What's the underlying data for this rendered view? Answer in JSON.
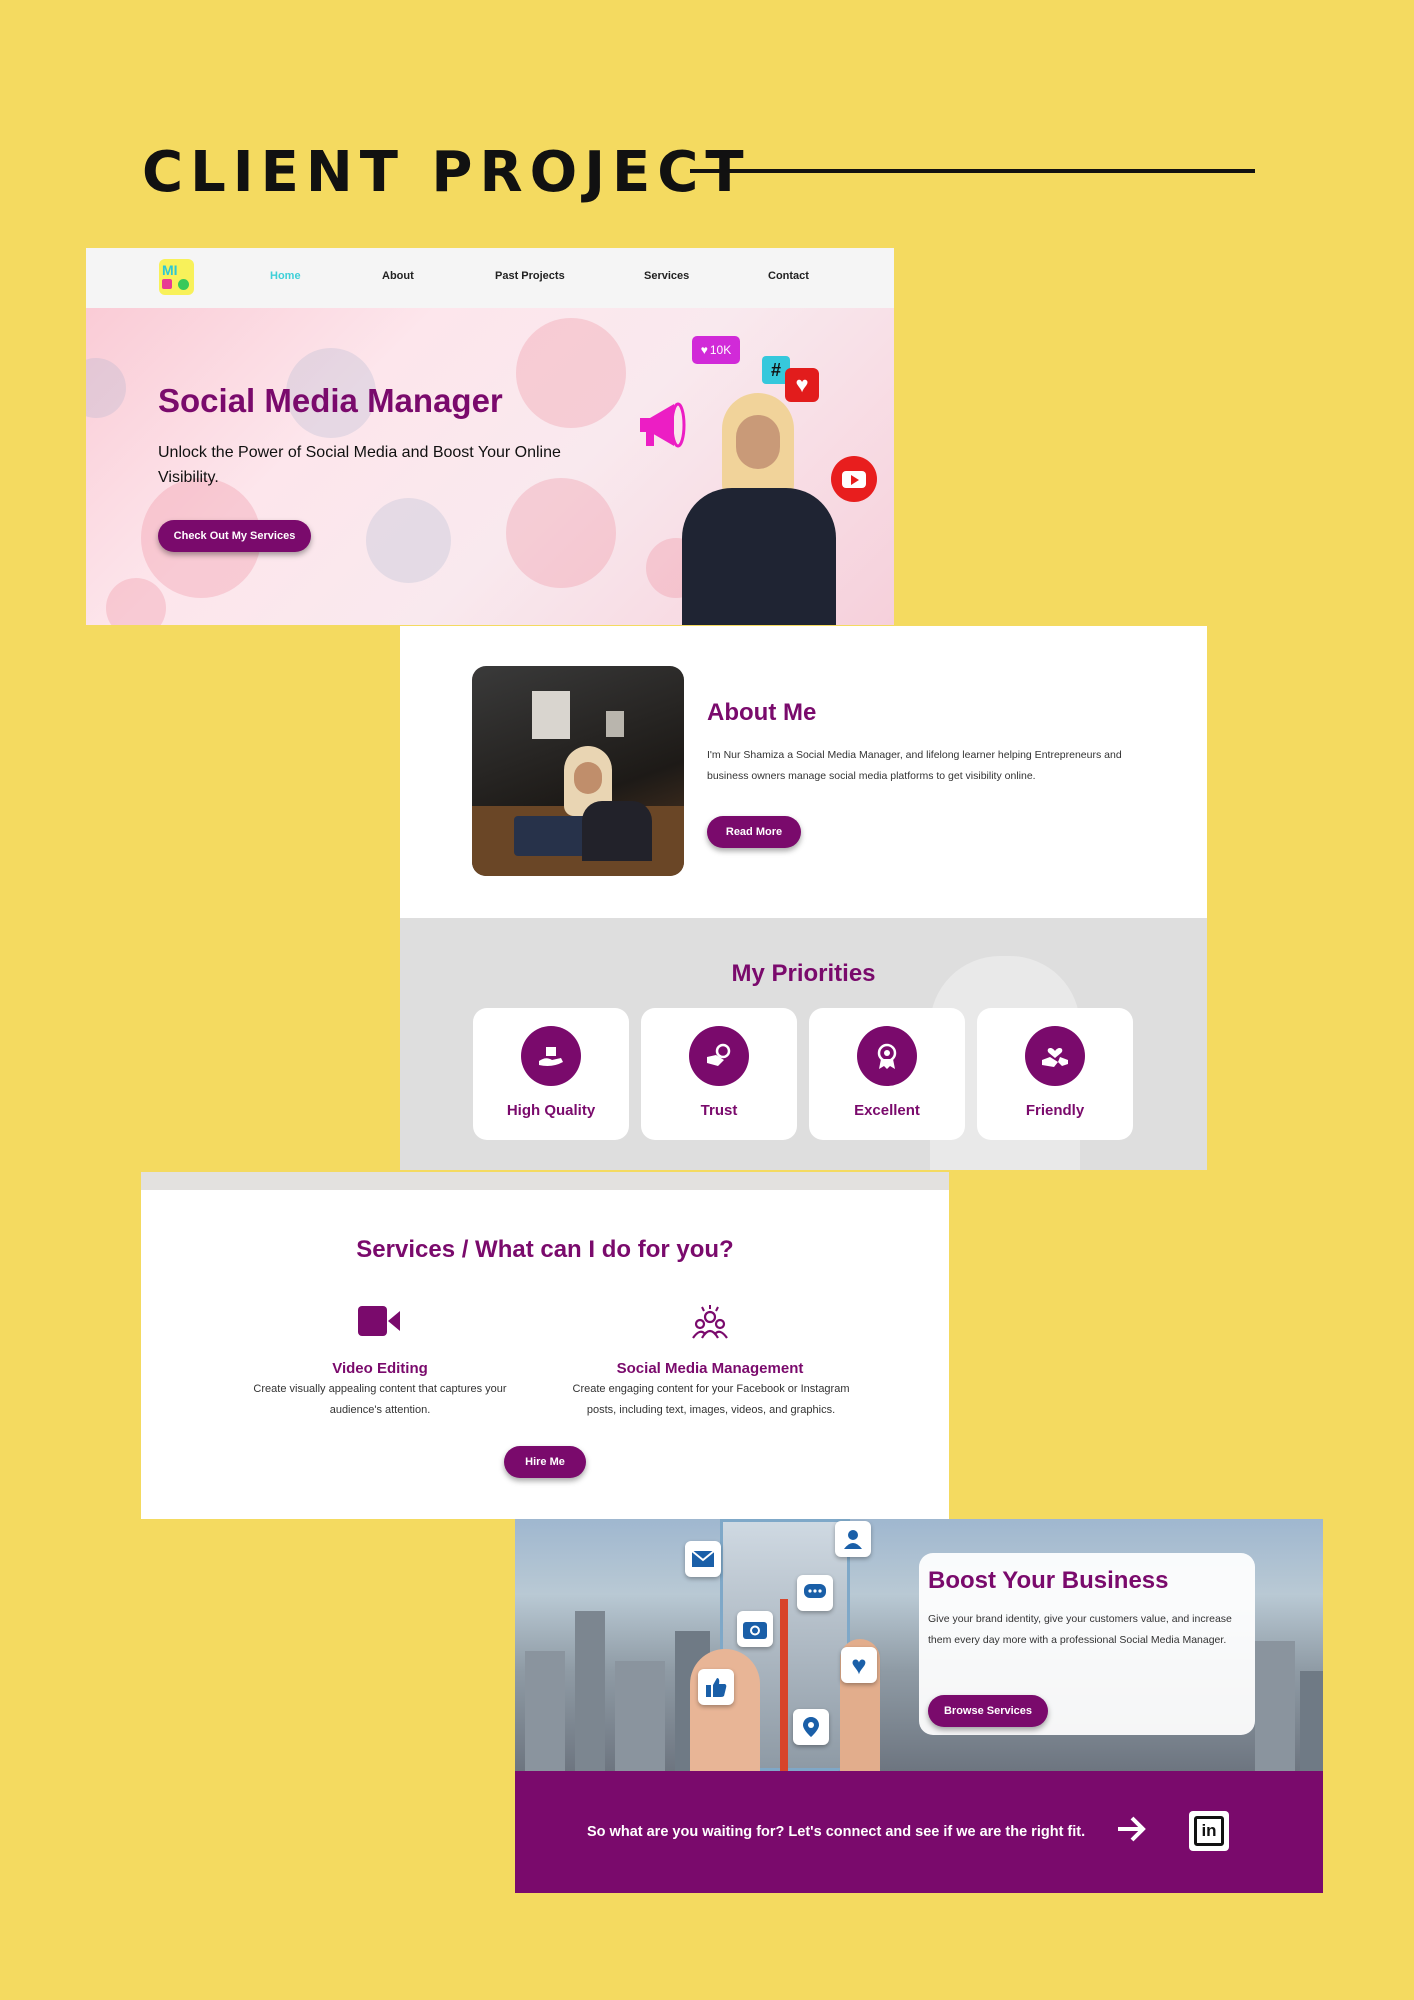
{
  "page": {
    "title": "CLIENT PROJECT"
  },
  "hero": {
    "nav": [
      "Home",
      "About",
      "Past Projects",
      "Services",
      "Contact"
    ],
    "active_nav": "Home",
    "logo_text": "MI",
    "title": "Social Media Manager",
    "subtitle": "Unlock the Power of Social Media and Boost Your Online Visibility.",
    "cta_label": "Check Out My Services",
    "like_count": "10K"
  },
  "about": {
    "title": "About Me",
    "text": "I'm Nur Shamiza a Social Media Manager, and lifelong learner helping Entrepreneurs and business owners manage social media platforms to get visibility online.",
    "button_label": "Read More"
  },
  "priorities": {
    "title": "My Priorities",
    "items": [
      {
        "label": "High Quality",
        "icon": "hand-gift-icon"
      },
      {
        "label": "Trust",
        "icon": "handshake-coins-icon"
      },
      {
        "label": "Excellent",
        "icon": "award-ribbon-icon"
      },
      {
        "label": "Friendly",
        "icon": "heart-handshake-icon"
      }
    ]
  },
  "services": {
    "title": "Services / What can I do for you?",
    "items": [
      {
        "name": "Video Editing",
        "desc": "Create visually appealing content that captures your audience's attention.",
        "icon": "video-camera-icon"
      },
      {
        "name": "Social Media Management",
        "desc": "Create engaging content for your Facebook or Instagram posts, including text, images, videos, and graphics.",
        "icon": "people-network-icon"
      }
    ],
    "button_label": "Hire Me"
  },
  "boost": {
    "title": "Boost Your Business",
    "text": "Give your brand identity, give your customers value, and increase them every day more with a professional Social Media Manager.",
    "button_label": "Browse Services",
    "cta_text": "So what are you waiting for? Let's connect and see if we are the right fit."
  },
  "colors": {
    "background": "#f4da60",
    "brand": "#7a0a6c",
    "accent_nav": "#3fd0d8"
  }
}
